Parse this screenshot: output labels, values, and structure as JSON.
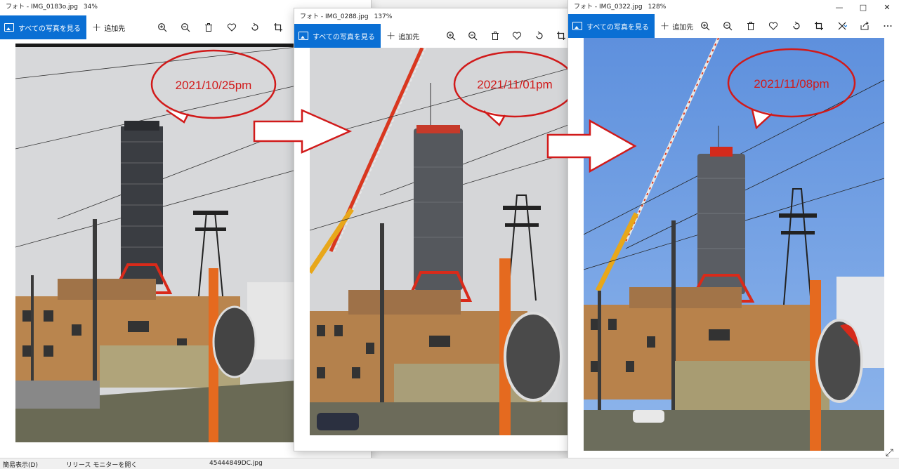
{
  "windows": [
    {
      "title": "フォト - IMG_0183o.jpg",
      "zoom": "34%",
      "all_photos_label": "すべての写真を見る",
      "add_to_label": "追加先",
      "date_label": "2021/10/25pm"
    },
    {
      "title": "フォト - IMG_0288.jpg",
      "zoom": "137%",
      "all_photos_label": "すべての写真を見る",
      "add_to_label": "追加先",
      "date_label": "2021/11/01pm"
    },
    {
      "title": "フォト - IMG_0322.jpg",
      "zoom": "128%",
      "all_photos_label": "すべての写真を見る",
      "add_to_label": "追加先",
      "date_label": "2021/11/08pm"
    }
  ],
  "toolbar_icons": [
    "zoom-in-icon",
    "zoom-out-icon",
    "delete-icon",
    "favorite-icon",
    "rotate-icon",
    "crop-icon"
  ],
  "taskbar": {
    "simple_view": "簡易表示(D)",
    "release_monitor": "リリース モニターを開く",
    "file_name": "45444849DC.jpg"
  },
  "colors": {
    "accent_blue": "#0a6fd4",
    "annotation_red": "#d11a1a",
    "sky_gray": "#d7d8da",
    "sky_blue": "#6e9ee2"
  }
}
